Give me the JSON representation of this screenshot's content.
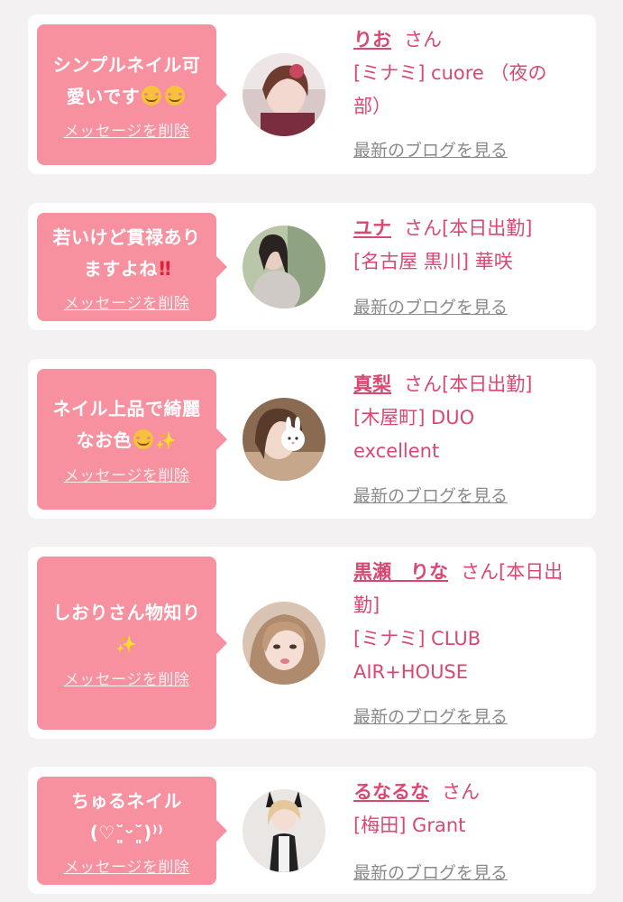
{
  "delete_label": "メッセージを削除",
  "blog_label": "最新のブログを見る",
  "san_label": "さん",
  "colors": {
    "bubble": "#f7909f",
    "name": "#d94871",
    "background": "#f3f1f2",
    "blog_link": "#8a8a8a"
  },
  "cards": [
    {
      "message_line1": "シンプルネイル可",
      "message_line2": "愛いです",
      "message_emojis": [
        "smiling-face-with-hearts-icon",
        "smiling-face-with-hearts-icon"
      ],
      "name": "りお",
      "status": "",
      "shop_line1": "[ミナミ] cuore （夜の",
      "shop_line2": "部）"
    },
    {
      "message_line1": "若いけど貫禄あり",
      "message_line2": "ますよね",
      "message_emojis": [
        "double-exclamation-icon"
      ],
      "name": "ユナ",
      "status": "[本日出勤]",
      "shop_line1": "[名古屋 黒川] 華咲",
      "shop_line2": ""
    },
    {
      "message_line1": "ネイル上品で綺麗",
      "message_line2": "なお色",
      "message_emojis": [
        "smiling-face-icon",
        "sparkles-icon"
      ],
      "name": "真梨",
      "status": "[本日出勤]",
      "shop_line1": "[木屋町] DUO",
      "shop_line2": "excellent"
    },
    {
      "message_line1": "しおりさん物知り",
      "message_line2": "",
      "message_emojis": [
        "sparkles-icon"
      ],
      "name": "黒瀬　りな",
      "status": "[本日出勤]",
      "shop_line1": "[ミナミ] CLUB",
      "shop_line2": "AIR+HOUSE"
    },
    {
      "message_line1": "ちゅるネイル",
      "message_line2": "(♡˘͈ᵕ˘͈)⁾⁾",
      "message_emojis": [],
      "name": "るなるな",
      "status": "",
      "shop_line1": "[梅田] Grant",
      "shop_line2": ""
    }
  ]
}
